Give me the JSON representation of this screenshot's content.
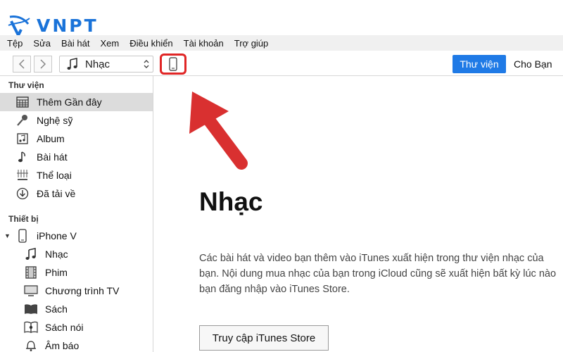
{
  "brand": {
    "logo_text": "VNPT"
  },
  "menu": [
    "Tệp",
    "Sửa",
    "Bài hát",
    "Xem",
    "Điều khiển",
    "Tài khoản",
    "Trợ giúp"
  ],
  "toolbar": {
    "source_label": "Nhạc",
    "tab_library": "Thư viện",
    "tab_for_you": "Cho Bạn",
    "active_tab_color": "#1f7ae6",
    "highlight_color": "#e02626"
  },
  "sidebar": {
    "library_heading": "Thư viện",
    "library_items": [
      {
        "label": "Thêm Gần đây",
        "icon": "calendar-grid-icon",
        "selected": true
      },
      {
        "label": "Nghệ sỹ",
        "icon": "microphone-icon"
      },
      {
        "label": "Album",
        "icon": "album-icon"
      },
      {
        "label": "Bài hát",
        "icon": "music-note-icon"
      },
      {
        "label": "Thể loại",
        "icon": "genre-icon"
      },
      {
        "label": "Đã tải về",
        "icon": "download-icon"
      }
    ],
    "devices_heading": "Thiết bị",
    "device": {
      "label": "iPhone V",
      "icon": "iphone-icon",
      "expanded": true
    },
    "device_items": [
      {
        "label": "Nhạc",
        "icon": "music-note-icon"
      },
      {
        "label": "Phim",
        "icon": "film-icon"
      },
      {
        "label": "Chương trình TV",
        "icon": "tv-icon"
      },
      {
        "label": "Sách",
        "icon": "book-icon"
      },
      {
        "label": "Sách nói",
        "icon": "audiobook-icon"
      },
      {
        "label": "Âm báo",
        "icon": "bell-icon"
      }
    ]
  },
  "main": {
    "title": "Nhạc",
    "description": "Các bài hát và video bạn thêm vào iTunes xuất hiện trong thư viện nhạc của bạn. Nội dung mua nhạc của bạn trong iCloud cũng sẽ xuất hiện bất kỳ lúc nào bạn đăng nhập vào iTunes Store.",
    "store_button": "Truy cập iTunes Store"
  }
}
